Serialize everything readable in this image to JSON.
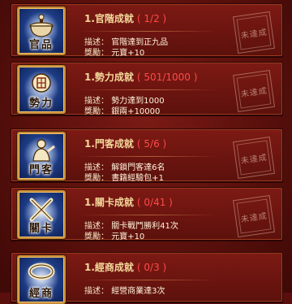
{
  "achievements": [
    {
      "icon": "official-cauldron-icon",
      "icon_caption": "官品",
      "title": "1.官階成就",
      "progress": "( 1/2 )",
      "desc_key": "描述：",
      "desc": "官階達到正九品",
      "reward_key": "獎勵：",
      "reward": "元寶+10",
      "stamp": "未達成"
    },
    {
      "icon": "power-seal-icon",
      "icon_caption": "勢力",
      "title": "1.勢力成就",
      "progress": "( 501/1000 )",
      "desc_key": "描述：",
      "desc": "勢力達到1000",
      "reward_key": "獎勵：",
      "reward": "銀兩+10000",
      "stamp": "未達成"
    },
    {
      "icon": "retainer-figure-icon",
      "icon_caption": "門客",
      "title": "1.門客成就",
      "progress": "( 5/6 )",
      "desc_key": "描述：",
      "desc": "解鎖門客達6名",
      "reward_key": "獎勵：",
      "reward": "書籍經驗包+1",
      "stamp": "未達成"
    },
    {
      "icon": "crossed-swords-icon",
      "icon_caption": "關卡",
      "title": "1.關卡成就",
      "progress": "( 0/41 )",
      "desc_key": "描述：",
      "desc": "關卡戰鬥勝利41次",
      "reward_key": "獎勵：",
      "reward": "元寶+10",
      "stamp": "未達成"
    },
    {
      "icon": "commerce-coin-icon",
      "icon_caption": "經商",
      "title": "1.經商成就",
      "progress": "( 0/3 )",
      "desc_key": "描述：",
      "desc": "經營商業達3次",
      "reward_key": "",
      "reward": "",
      "stamp": ""
    }
  ],
  "colors": {
    "title": "#f4d79a",
    "progress": "#ff4a48",
    "background": "#5a0f0c"
  }
}
